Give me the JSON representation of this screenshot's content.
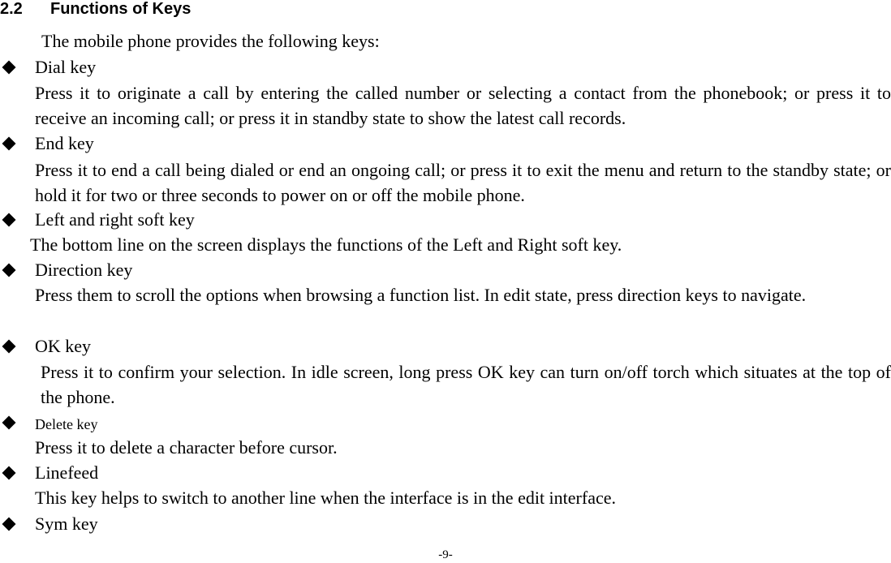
{
  "section": {
    "number": "2.2",
    "title": "Functions of Keys",
    "intro": "The mobile phone provides the following keys:"
  },
  "keys": [
    {
      "name": "Dial key",
      "description": "Press it to originate a call by entering the called number or selecting a contact from the phonebook; or press it to receive an incoming call; or press it in standby state to show the latest call records."
    },
    {
      "name": "End key",
      "description": "Press it to end a call being dialed or end an ongoing call; or press it to exit the menu and return to the standby state; or hold it for two or three seconds to power on or off the mobile phone."
    },
    {
      "name": "Left and right soft key",
      "description": "The bottom line on the screen displays the functions of the Left and Right soft key."
    },
    {
      "name": "Direction key",
      "description": "Press them to scroll the options when browsing a function list. In edit state, press direction keys to navigate."
    },
    {
      "name": "OK key",
      "description": "Press it to confirm your selection. In idle screen, long press OK key can turn on/off torch which situates at the top of the phone."
    },
    {
      "name": "Delete key",
      "description": "Press it to delete a character before cursor."
    },
    {
      "name": "Linefeed",
      "description": "This key helps to switch to another line when the interface is in the edit interface."
    },
    {
      "name": "Sym key",
      "description": ""
    }
  ],
  "footer": {
    "page_number": "-9-"
  }
}
